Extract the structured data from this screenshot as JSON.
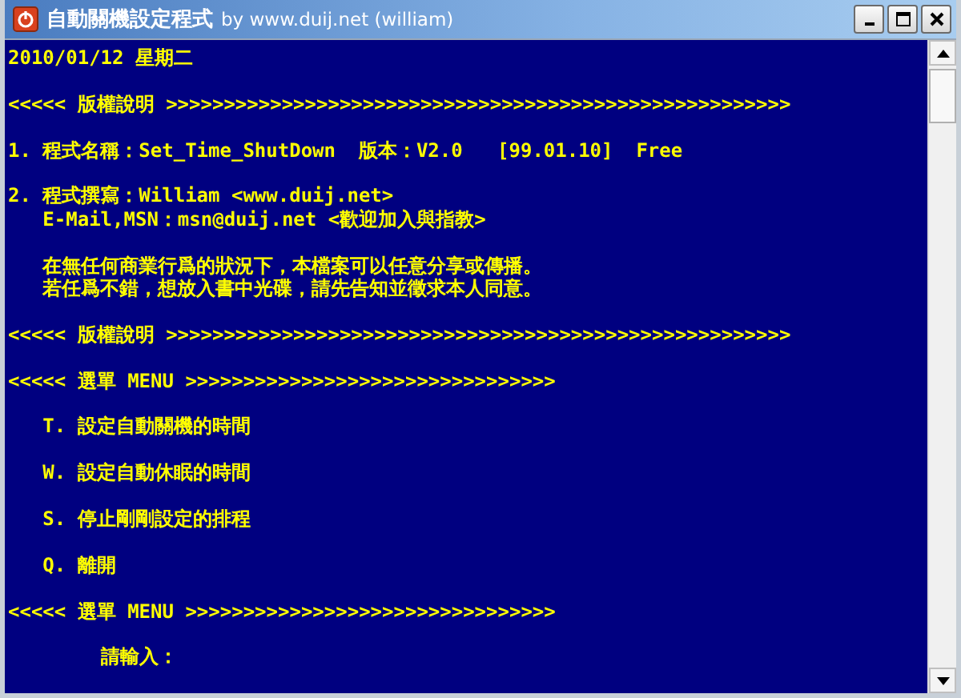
{
  "window": {
    "title": "自動關機設定程式",
    "subtitle": "by www.duij.net (william)"
  },
  "console": {
    "blocks": [
      [
        "2010/01/12 星期二"
      ],
      [
        "<<<<< 版權說明 >>>>>>>>>>>>>>>>>>>>>>>>>>>>>>>>>>>>>>>>>>>>>>>>>>>>>>"
      ],
      [
        "1. 程式名稱：Set_Time_ShutDown  版本：V2.0   [99.01.10]  Free"
      ],
      [
        "2. 程式撰寫：William <www.duij.net>",
        "   E-Mail,MSN：msn@duij.net <歡迎加入與指教>"
      ],
      [
        "   在無任何商業行爲的狀況下，本檔案可以任意分享或傳播。",
        "   若任爲不錯，想放入書中光碟，請先告知並徵求本人同意。"
      ],
      [
        "<<<<< 版權說明 >>>>>>>>>>>>>>>>>>>>>>>>>>>>>>>>>>>>>>>>>>>>>>>>>>>>>>"
      ],
      [
        "<<<<< 選單 MENU >>>>>>>>>>>>>>>>>>>>>>>>>>>>>>>>"
      ],
      [
        "   T. 設定自動關機的時間"
      ],
      [
        "   W. 設定自動休眠的時間"
      ],
      [
        "   S. 停止剛剛設定的排程"
      ],
      [
        "   Q. 離開"
      ],
      [
        "<<<<< 選單 MENU >>>>>>>>>>>>>>>>>>>>>>>>>>>>>>>>"
      ],
      [
        "        請輸入："
      ]
    ]
  }
}
